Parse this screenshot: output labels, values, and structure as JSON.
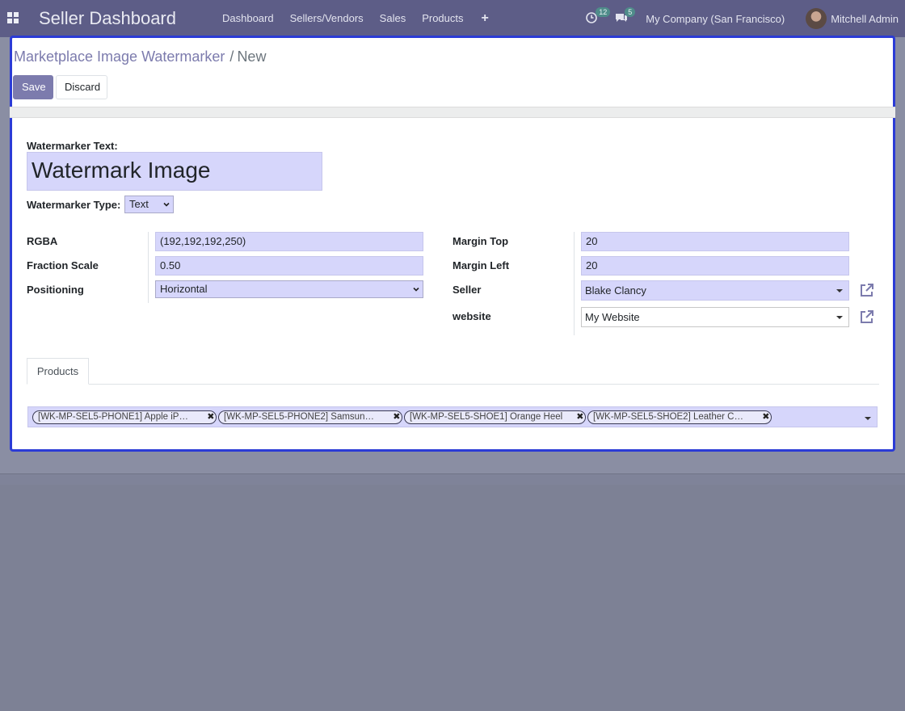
{
  "navbar": {
    "brand": "Seller Dashboard",
    "menu": [
      "Dashboard",
      "Sellers/Vendors",
      "Sales",
      "Products"
    ],
    "plus": "+",
    "activity_count": "12",
    "messages_count": "5",
    "company": "My Company (San Francisco)",
    "user": "Mitchell Admin"
  },
  "breadcrumb": {
    "parent": "Marketplace Image Watermarker",
    "separator": "/",
    "current": "New"
  },
  "buttons": {
    "save": "Save",
    "discard": "Discard"
  },
  "form": {
    "watermarker_text_label": "Watermarker Text:",
    "watermarker_text_value": "Watermark Image",
    "watermarker_type_label": "Watermarker Type:",
    "watermarker_type_value": "Text",
    "left": {
      "rgba_label": "RGBA",
      "rgba_value": "(192,192,192,250)",
      "fraction_label": "Fraction Scale",
      "fraction_value": "0.50",
      "positioning_label": "Positioning",
      "positioning_value": "Horizontal"
    },
    "right": {
      "margin_top_label": "Margin Top",
      "margin_top_value": "20",
      "margin_left_label": "Margin Left",
      "margin_left_value": "20",
      "seller_label": "Seller",
      "seller_value": "Blake Clancy",
      "website_label": "website",
      "website_value": "My Website"
    }
  },
  "tabs": {
    "products": "Products"
  },
  "products": [
    "[WK-MP-SEL5-PHONE1] Apple iP…",
    "[WK-MP-SEL5-PHONE2] Samsun…",
    "[WK-MP-SEL5-SHOE1] Orange Heel",
    "[WK-MP-SEL5-SHOE2] Leather C…"
  ],
  "colors": {
    "navbar": "#5d5d87",
    "accent": "#7c7bad",
    "highlight_border": "#2b3bd6",
    "field_bg": "#d6d6fb"
  }
}
